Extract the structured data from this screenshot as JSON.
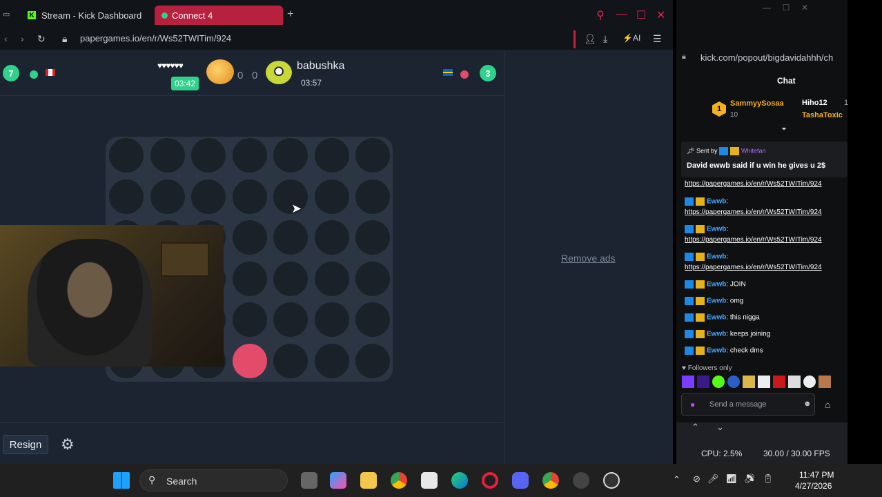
{
  "browser": {
    "tabs": [
      {
        "label": "Stream - Kick Dashboard"
      },
      {
        "label": "Connect 4"
      }
    ],
    "url": "papergames.io/en/r/Ws52TWITim/924",
    "ai_label": "AI"
  },
  "game": {
    "left_player": {
      "level": "7",
      "lives": "♥♥♥♥♥♥",
      "timer": "03:42",
      "score": "0"
    },
    "right_player": {
      "name": "babushka",
      "level": "3",
      "timer": "03:57",
      "score": "0"
    },
    "remove_ads": "Remove ads",
    "resign_label": "Resign",
    "board": {
      "columns": 7,
      "rows": 6,
      "red_piece": {
        "col": 3,
        "row": 5
      }
    }
  },
  "chat": {
    "url": "kick.com/popout/bigdavidahhh/ch",
    "title": "Chat",
    "top_user": {
      "rank": "1",
      "name": "SammyySosaa",
      "count": "10"
    },
    "side_users": [
      "Hiho12",
      "TashaToxic"
    ],
    "side_count": "1",
    "pinned": {
      "sent_by_label": "Sent by",
      "sender": "Whitefan",
      "message": "David ewwb said if u win he gives u 2$"
    },
    "messages": [
      {
        "user": "",
        "text": "https://papergames.io/en/r/Ws52TWITim/924"
      },
      {
        "user": "Ewwb",
        "text": "https://papergames.io/en/r/Ws52TWITim/924"
      },
      {
        "user": "Ewwb",
        "text": "https://papergames.io/en/r/Ws52TWITim/924"
      },
      {
        "user": "Ewwb",
        "text": "https://papergames.io/en/r/Ws52TWITim/924"
      },
      {
        "user": "Ewwb",
        "text": "JOIN"
      },
      {
        "user": "Ewwb",
        "text": "omg"
      },
      {
        "user": "Ewwb",
        "text": "this nigga"
      },
      {
        "user": "Ewwb",
        "text": "keeps joining"
      },
      {
        "user": "Ewwb",
        "text": "check dms"
      }
    ],
    "followers_only": "Followers only",
    "send_placeholder": "Send a message"
  },
  "obs": {
    "cpu": "CPU: 2.5%",
    "fps": "30.00 / 30.00 FPS"
  },
  "taskbar": {
    "search": "Search",
    "time": "11:47 PM",
    "date": "4/27/2026"
  }
}
